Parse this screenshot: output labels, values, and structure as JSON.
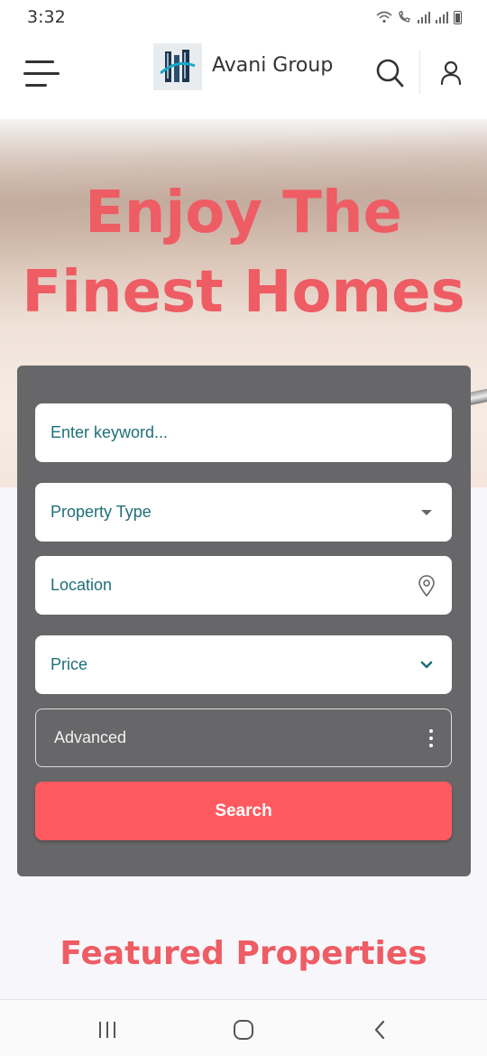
{
  "status_bar": {
    "time": "3:32"
  },
  "header": {
    "brand": "Avani Group"
  },
  "hero": {
    "title_line1": "Enjoy The",
    "title_line2": "Finest Homes"
  },
  "search_form": {
    "keyword_placeholder": "Enter keyword...",
    "property_type": "Property Type",
    "location": "Location",
    "price": "Price",
    "advanced": "Advanced",
    "submit_label": "Search"
  },
  "featured": {
    "heading": "Featured Properties"
  },
  "colors": {
    "accent": "#ee5c64",
    "button": "#ff5a60",
    "panel": "#676769",
    "field_text": "#1f6f78"
  }
}
